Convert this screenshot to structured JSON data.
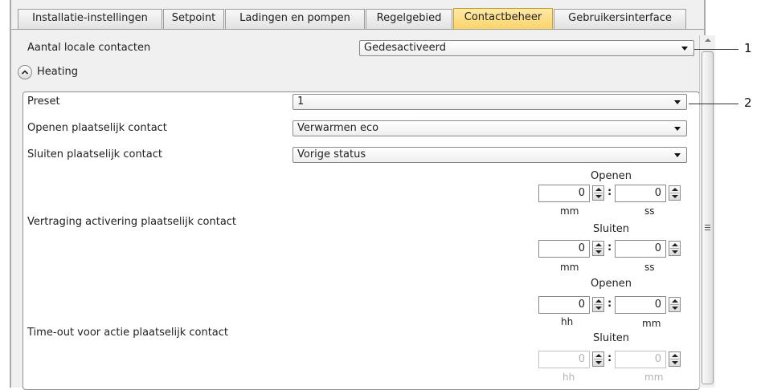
{
  "tabs": [
    {
      "label": "Installatie-instellingen",
      "active": false
    },
    {
      "label": "Setpoint",
      "active": false
    },
    {
      "label": "Ladingen en pompen",
      "active": false
    },
    {
      "label": "Regelgebied",
      "active": false
    },
    {
      "label": "Contactbeheer",
      "active": true
    },
    {
      "label": "Gebruikersinterface",
      "active": false
    }
  ],
  "local_contacts": {
    "label": "Aantal locale contacten",
    "value": "Gedesactiveerd"
  },
  "section": {
    "title": "Heating"
  },
  "rows": {
    "preset": {
      "label": "Preset",
      "value": "1"
    },
    "open": {
      "label": "Openen plaatselijk contact",
      "value": "Verwarmen eco"
    },
    "close": {
      "label": "Sluiten plaatselijk contact",
      "value": "Vorige status"
    },
    "delay": {
      "label": "Vertraging activering plaatselijk contact"
    },
    "timeout": {
      "label": "Time-out voor actie plaatselijk contact"
    }
  },
  "delay_open": {
    "title": "Openen",
    "a": "0",
    "b": "0",
    "unit_a": "mm",
    "unit_b": "ss"
  },
  "delay_close": {
    "title": "Sluiten",
    "a": "0",
    "b": "0",
    "unit_a": "mm",
    "unit_b": "ss"
  },
  "timeout_open": {
    "title": "Openen",
    "a": "0",
    "b": "0",
    "unit_a": "hh",
    "unit_b": "mm"
  },
  "timeout_close": {
    "title": "Sluiten",
    "a": "0",
    "b": "0",
    "unit_a": "hh",
    "unit_b": "mm",
    "disabled": true
  },
  "colon": ":",
  "callouts": [
    "1",
    "2"
  ],
  "colors": {
    "active_tab": "#fbd46a",
    "panel_bg": "#f0f0f0"
  }
}
